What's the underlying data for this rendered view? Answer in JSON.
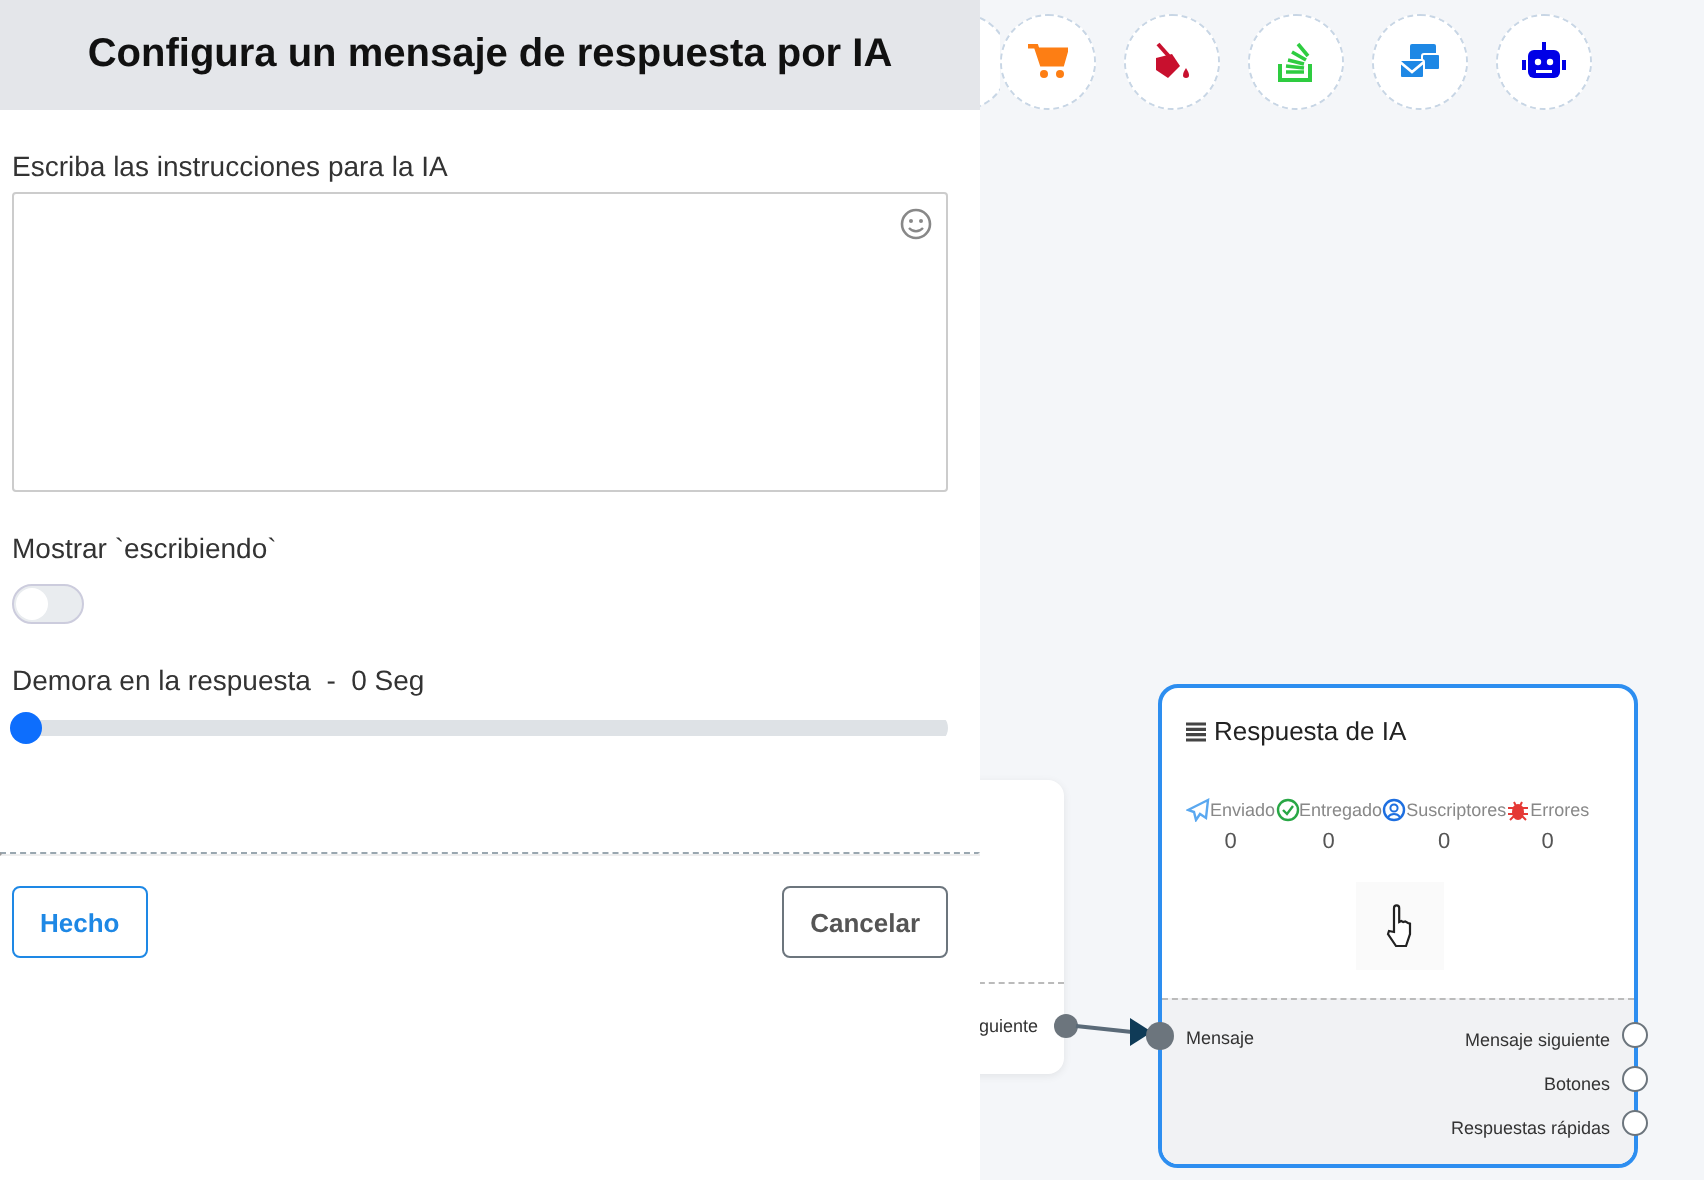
{
  "panel": {
    "title": "Configura un mensaje de respuesta por IA",
    "instructions": {
      "label": "Escriba las instrucciones para la IA"
    },
    "typing": {
      "label": "Mostrar `escribiendo`",
      "on": false
    },
    "delay": {
      "label": "Demora en la respuesta  -  0 Seg",
      "level": 0
    },
    "buttons": [
      {
        "label": "Hecho",
        "kind": "primary"
      },
      {
        "label": "Cancelar",
        "kind": "secondary"
      }
    ]
  },
  "toolbar": [
    {
      "kind": "cart"
    },
    {
      "kind": "bucket"
    },
    {
      "kind": "stack"
    },
    {
      "kind": "mail"
    },
    {
      "kind": "robot"
    }
  ],
  "previous_node": {
    "output": "guiente"
  },
  "node": {
    "title": "Respuesta de IA",
    "stats": [
      {
        "kind": "sent",
        "label": "Enviado",
        "value": "0"
      },
      {
        "kind": "delivered",
        "label": "Entregado",
        "value": "0"
      },
      {
        "kind": "subscribers",
        "label": "Suscriptores",
        "value": "0"
      },
      {
        "kind": "errors",
        "label": "Errores",
        "value": "0"
      }
    ],
    "input": "Mensaje",
    "outputs": [
      "Mensaje siguiente",
      "Botones",
      "Respuestas rápidas"
    ]
  }
}
